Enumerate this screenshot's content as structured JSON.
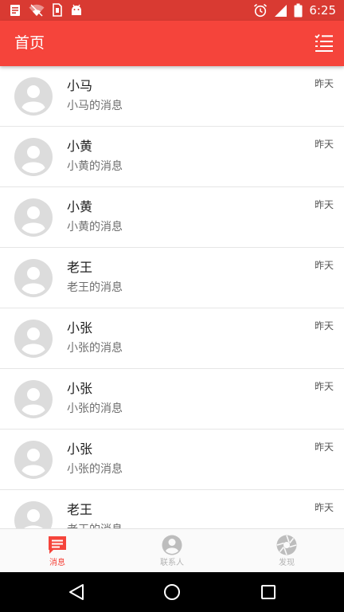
{
  "status_bar": {
    "time": "6:25",
    "icons": [
      "notes-icon",
      "wifi-off-icon",
      "sim-card-icon",
      "android-icon",
      "alarm-icon",
      "signal-icon",
      "battery-icon"
    ]
  },
  "app_bar": {
    "title": "首页",
    "menu_icon": "list-menu-icon"
  },
  "conversations": [
    {
      "name": "小马",
      "message": "小马的消息",
      "time": "昨天"
    },
    {
      "name": "小黄",
      "message": "小黄的消息",
      "time": "昨天"
    },
    {
      "name": "小黄",
      "message": "小黄的消息",
      "time": "昨天"
    },
    {
      "name": "老王",
      "message": "老王的消息",
      "time": "昨天"
    },
    {
      "name": "小张",
      "message": "小张的消息",
      "time": "昨天"
    },
    {
      "name": "小张",
      "message": "小张的消息",
      "time": "昨天"
    },
    {
      "name": "小张",
      "message": "小张的消息",
      "time": "昨天"
    },
    {
      "name": "老王",
      "message": "老王的消息",
      "time": "昨天"
    }
  ],
  "bottom_nav": [
    {
      "label": "消息",
      "icon": "message-icon",
      "active": true
    },
    {
      "label": "联系人",
      "icon": "contact-icon",
      "active": false
    },
    {
      "label": "发现",
      "icon": "discover-icon",
      "active": false
    }
  ],
  "colors": {
    "primary": "#f5443b",
    "status_bar": "#d93a32",
    "inactive": "#b3b3b3",
    "avatar": "#dcdcdc"
  }
}
